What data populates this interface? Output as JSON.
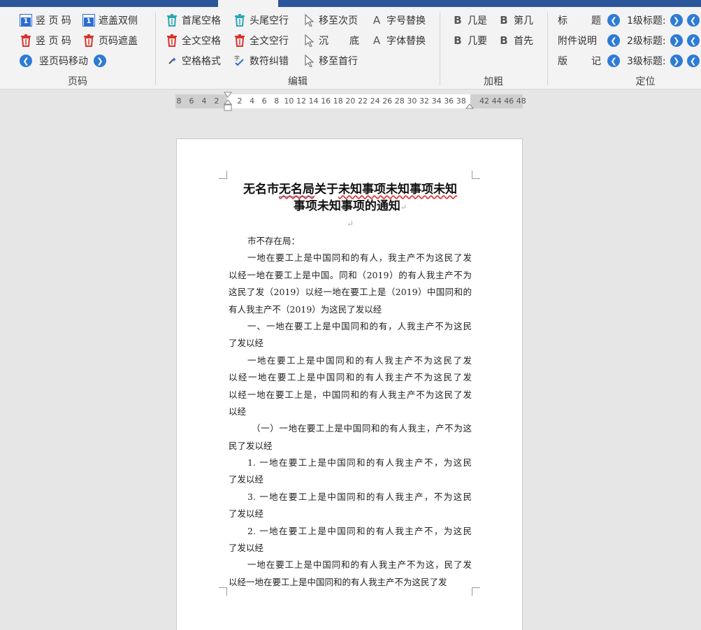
{
  "ribbon": {
    "page_group": {
      "label": "页码",
      "btn_vpage_insert": "竖 页 码",
      "btn_cover_double": "遮盖双侧",
      "btn_vpage_delete": "竖 页 码",
      "btn_page_cover": "页码遮盖",
      "btn_vpage_move": "竖页码移动"
    },
    "edit_group": {
      "label": "编辑",
      "btn_trim_spaces": "首尾空格",
      "btn_head_tail_lines": "头尾空行",
      "btn_move_next_page": "移至次页",
      "btn_font_size_replace": "字号替换",
      "btn_all_spaces": "全文空格",
      "btn_all_blank_lines": "全文空行",
      "btn_sink_bottom_left": "沉",
      "btn_sink_bottom_right": "底",
      "btn_font_replace": "字体替换",
      "btn_blank_format": "空格格式",
      "btn_number_fix": "数符纠错",
      "btn_move_first_line": "移至首行"
    },
    "bold_group": {
      "label": "加粗",
      "btn_jishi": "几是",
      "btn_diji": "第几",
      "btn_jiyao": "几要",
      "btn_shouxian": "首先"
    },
    "locate_group": {
      "label": "定位",
      "title_left": "标",
      "title_right": "题",
      "attach_note": "附件说明",
      "banji_left": "版",
      "banji_right": "记",
      "level1": "1级标题:",
      "level2": "2级标题:",
      "level3": "3级标题:"
    }
  },
  "ruler": {
    "left_numbers": [
      "8",
      "6",
      "4",
      "2"
    ],
    "right_numbers": [
      "2",
      "4",
      "6",
      "8",
      "10",
      "12",
      "14",
      "16",
      "18",
      "20",
      "22",
      "24",
      "26",
      "28",
      "30",
      "32",
      "34",
      "36",
      "38"
    ],
    "margin_numbers": [
      "42",
      "44",
      "46",
      "48"
    ]
  },
  "document": {
    "title_line1_a": "无名市",
    "title_line1_b": "无名局",
    "title_line1_c": "关于",
    "title_line1_d": "未知事项未知事项未知",
    "title_line2": "事项未知事项的通知",
    "lines": [
      {
        "text": "市不存在局：",
        "style": "ind last"
      },
      {
        "text": "一地在要工上是中国同和的有人，我主产不为这民了发",
        "style": "ind"
      },
      {
        "text": "以经一地在要工上是中国。同和（2019）的有人我主产不为",
        "style": ""
      },
      {
        "text": "这民了发（2019）以经一地在要工上是（2019）中国同和的",
        "style": ""
      },
      {
        "text": "有人我主产不（2019）为这民了发以经",
        "style": "last"
      },
      {
        "text": "一、一地在要工上是中国同和的有，人我主产不为这民",
        "style": "ind"
      },
      {
        "text": "了发以经",
        "style": "last"
      },
      {
        "text": "一地在要工上是中国同和的有人我主产不为这民了发",
        "style": "ind"
      },
      {
        "text": "以经一地在要工上是中国同和的有人我主产不为这民了发",
        "style": ""
      },
      {
        "text": "以经一地在要工上是，中国同和的有人我主产不为这民了发",
        "style": ""
      },
      {
        "text": "以经",
        "style": "last"
      },
      {
        "text": "（一）一地在要工上是中国同和的有人我主，产不为这",
        "style": "ind2"
      },
      {
        "text": "民了发以经",
        "style": "last"
      },
      {
        "text": "1. 一地在要工上是中国同和的有人我主产不，为这民",
        "style": "ind"
      },
      {
        "text": "了发以经",
        "style": "last"
      },
      {
        "text": "3. 一地在要工上是中国同和的有人我主产，不为这民",
        "style": "ind"
      },
      {
        "text": "了发以经",
        "style": "last"
      },
      {
        "text": "2. 一地在要工上是中国同和的有人我主产不，为这民",
        "style": "ind"
      },
      {
        "text": "了发以经",
        "style": "last"
      },
      {
        "text": "一地在要工上是中国同和的有人我主产不为这，民了发",
        "style": "ind"
      },
      {
        "text": "以经一地在要工上是中国同和的有人我主产不为这民了发",
        "style": "last"
      }
    ]
  },
  "colors": {
    "accent": "#2b579a",
    "icon_blue": "#2b6cd4",
    "icon_teal": "#2aa7b5",
    "icon_red": "#d9342b",
    "nav_circle": "#2e7bd6"
  }
}
